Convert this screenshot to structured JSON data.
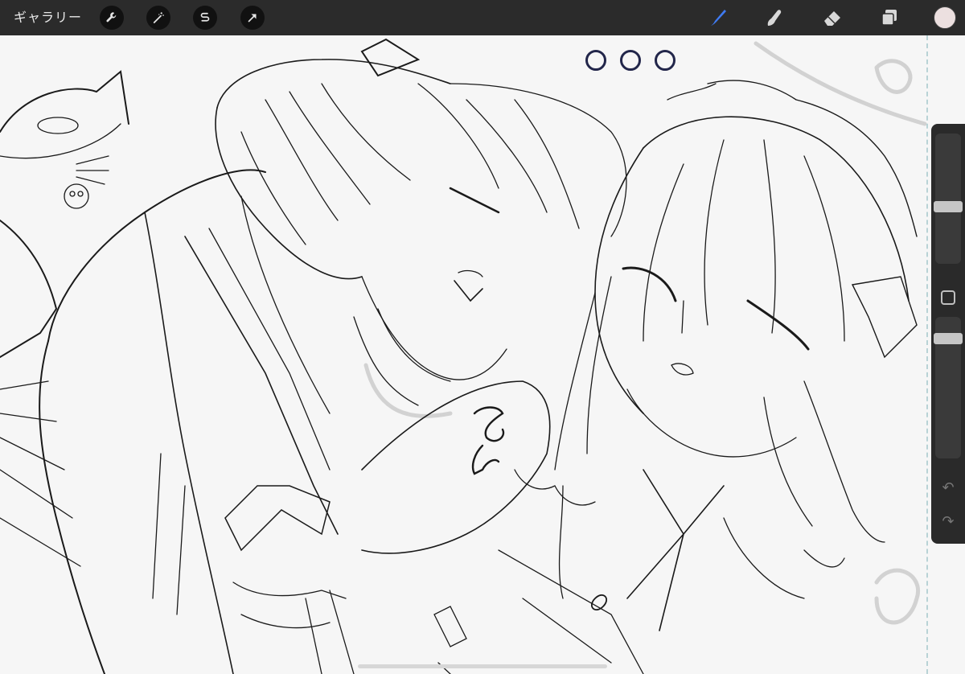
{
  "toolbar": {
    "gallery_label": "ギャラリー",
    "left_tools": [
      {
        "name": "actions",
        "icon": "wrench-icon"
      },
      {
        "name": "adjustments",
        "icon": "magic-wand-icon"
      },
      {
        "name": "selection",
        "icon": "selection-s-icon"
      },
      {
        "name": "transform",
        "icon": "arrow-cursor-icon"
      }
    ],
    "right_tools": [
      {
        "name": "brush",
        "icon": "brush-icon",
        "active": true
      },
      {
        "name": "smudge",
        "icon": "smudge-icon"
      },
      {
        "name": "eraser",
        "icon": "eraser-icon"
      },
      {
        "name": "layers",
        "icon": "layers-icon"
      }
    ],
    "active_color": "#ece0e0",
    "accent_color": "#3f7bf2"
  },
  "sidebar": {
    "brush_size_level": 0.55,
    "opacity_level": 0.95,
    "undo_icon": "undo-arrow-icon",
    "redo_icon": "redo-arrow-icon"
  },
  "canvas": {
    "indicator_dots": 3,
    "description_icon": "line-art-drawing"
  }
}
